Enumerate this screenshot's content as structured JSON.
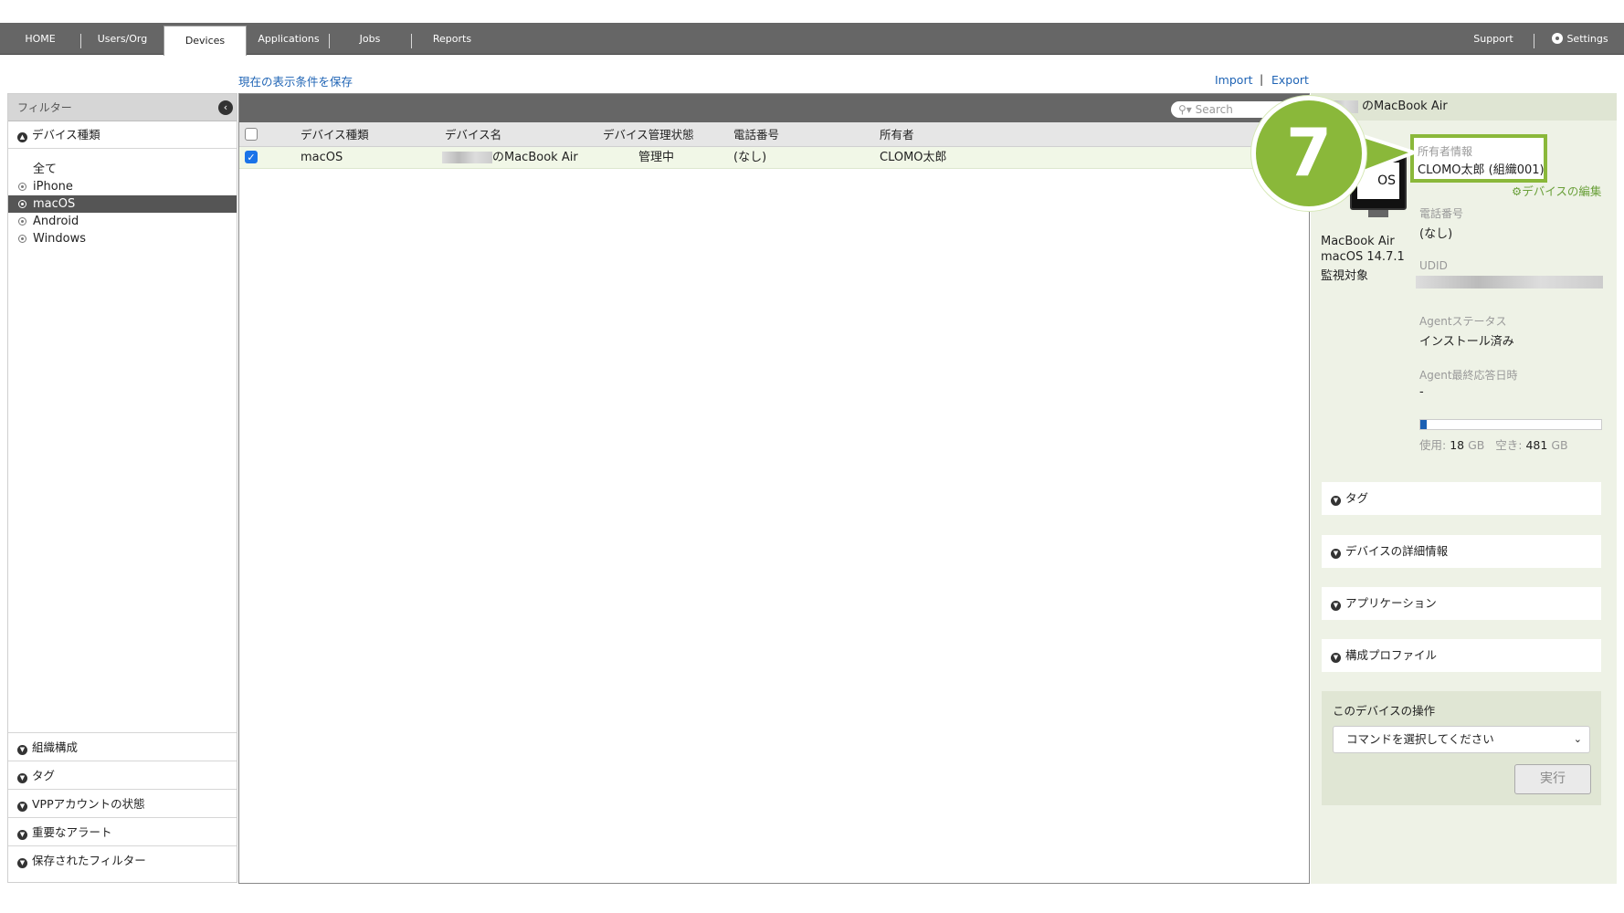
{
  "nav": {
    "tabs": [
      "HOME",
      "Users/Org",
      "Devices",
      "Applications",
      "Jobs",
      "Reports"
    ],
    "active_tab": "Devices",
    "support": "Support",
    "settings": "Settings"
  },
  "links": {
    "save_view": "現在の表示条件を保存",
    "import": "Import",
    "separator": "|",
    "export": "Export"
  },
  "filter": {
    "title": "フィルター",
    "device_type_section": "デバイス種類",
    "types": [
      "全て",
      "iPhone",
      "macOS",
      "Android",
      "Windows"
    ],
    "selected_type": "macOS",
    "bottom_sections": [
      "組織構成",
      "タグ",
      "VPPアカウントの状態",
      "重要なアラート",
      "保存されたフィルター"
    ]
  },
  "list": {
    "search_placeholder": "Search",
    "columns": [
      "デバイス種類",
      "デバイス名",
      "デバイス管理状態",
      "電話番号",
      "所有者"
    ],
    "rows": [
      {
        "checked": true,
        "device_type": "macOS",
        "device_name": "のMacBook Air",
        "status": "管理中",
        "phone": "(なし)",
        "owner": "CLOMO太郎"
      }
    ]
  },
  "detail": {
    "title": "のMacBook Air",
    "icon_text": "OS",
    "model": "MacBook Air",
    "os": "macOS 14.7.1",
    "supervised": "監視対象",
    "owner_label": "所有者情報",
    "owner_value": "CLOMO太郎 (組織001)",
    "edit_link": "デバイスの編集",
    "phone_label": "電話番号",
    "phone_value": "(なし)",
    "udid_label": "UDID",
    "agent_status_label": "Agentステータス",
    "agent_status_value": "インストール済み",
    "agent_last_label": "Agent最終応答日時",
    "agent_last_value": "-",
    "storage": {
      "used_label": "使用:",
      "used_value": "18",
      "used_unit": "GB",
      "free_label": "空き:",
      "free_value": "481",
      "free_unit": "GB",
      "used_fraction": 0.036
    },
    "sections": [
      "タグ",
      "デバイスの詳細情報",
      "アプリケーション",
      "構成プロファイル"
    ],
    "ops_title": "このデバイスの操作",
    "command_placeholder": "コマンドを選択してください",
    "run_button": "実行"
  },
  "step_badge": "7",
  "colors": {
    "nav_bg": "#666666",
    "accent_green": "#8ab83a",
    "link_blue": "#1f64b5",
    "selected_row": "#f1f7e7"
  }
}
